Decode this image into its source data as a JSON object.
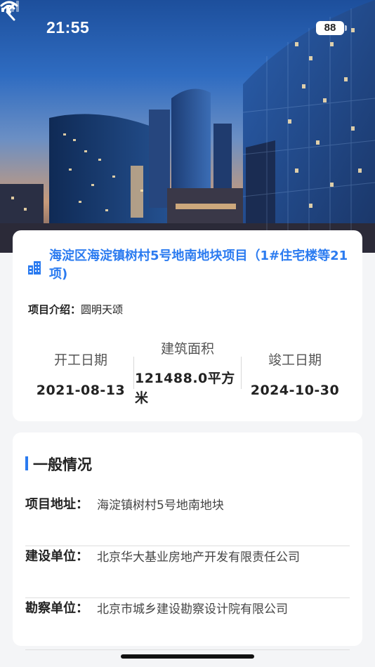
{
  "status_bar": {
    "time": "21:55",
    "battery": "88"
  },
  "project": {
    "title": "海淀区海淀镇树村5号地南地块项目（1#住宅楼等21项)",
    "intro_label": "项目介绍：",
    "intro_value": "圆明天颂",
    "stats": {
      "start_label": "开工日期",
      "start_value": "2021-08-13",
      "area_label": "建筑面积",
      "area_value": "121488.0平方米",
      "end_label": "竣工日期",
      "end_value": "2024-10-30"
    }
  },
  "general": {
    "title": "一般情况",
    "rows": [
      {
        "label": "项目地址：",
        "value": "海淀镇树村5号地南地块"
      },
      {
        "label": "建设单位：",
        "value": "北京华大基业房地产开发有限责任公司"
      },
      {
        "label": "勘察单位：",
        "value": "北京市城乡建设勘察设计院有限公司"
      }
    ]
  },
  "colors": {
    "accent": "#2b7bf0",
    "background": "#f4f5f7"
  },
  "icons": [
    "signal-icon",
    "wifi-icon",
    "back-arrow-icon",
    "building-icon"
  ]
}
